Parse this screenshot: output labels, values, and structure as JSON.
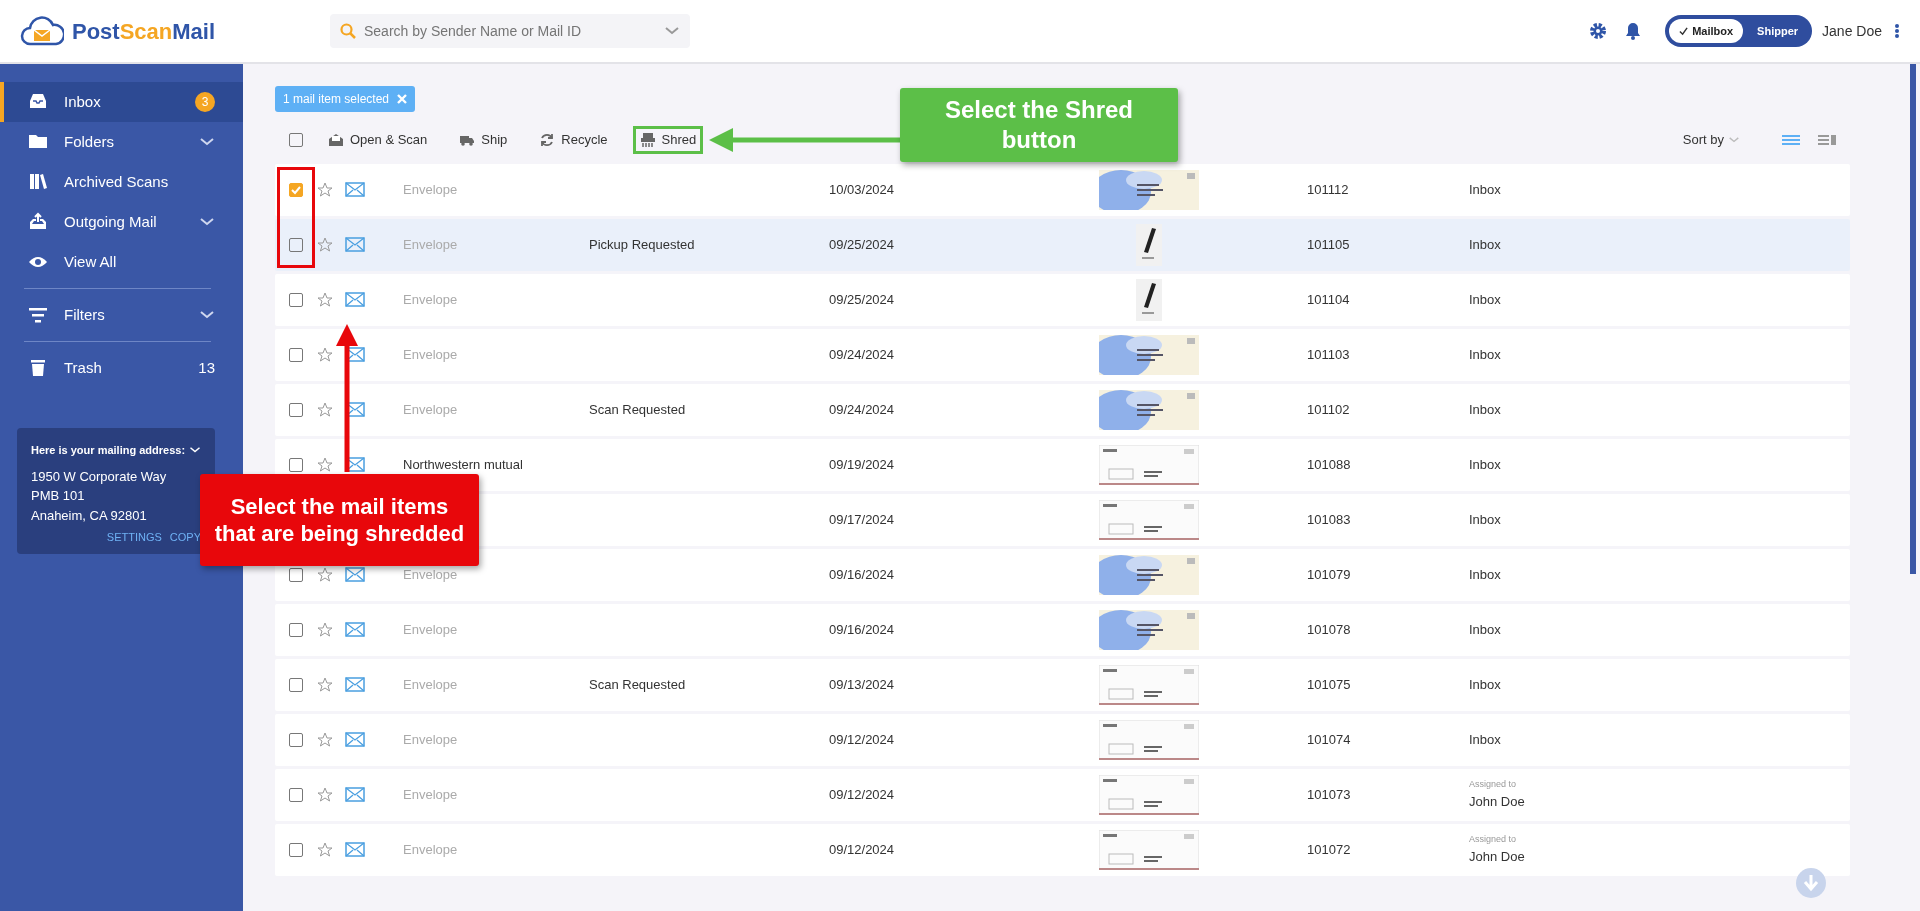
{
  "header": {
    "logo": [
      "Post",
      "Scan",
      "Mail"
    ],
    "search": {
      "placeholder": "Search by Sender Name or Mail ID"
    },
    "mode_toggle": [
      {
        "label": "Mailbox",
        "selected": true
      },
      {
        "label": "Shipper",
        "selected": false
      }
    ],
    "user": "Jane Doe"
  },
  "sidebar": {
    "groups": [
      [
        {
          "kind": "inbox",
          "label": "Inbox",
          "badge": "3",
          "selected": true
        },
        {
          "kind": "folder",
          "label": "Folders",
          "expanded": false,
          "selected": false
        },
        {
          "kind": "archive",
          "label": "Archived Scans",
          "selected": false
        },
        {
          "kind": "outbox",
          "label": "Outgoing Mail",
          "expanded": false,
          "selected": false
        },
        {
          "kind": "eye",
          "label": "View All",
          "selected": false
        }
      ],
      [
        {
          "kind": "filter",
          "label": "Filters",
          "expanded": false,
          "selected": false
        }
      ],
      [
        {
          "kind": "trash",
          "label": "Trash",
          "count": "13",
          "selected": false
        }
      ]
    ],
    "address": {
      "title": "Here is your mailing address:",
      "expanded": true,
      "lines": [
        "1950 W Corporate Way",
        "PMB 101",
        "Anaheim, CA 92801"
      ],
      "links": [
        "SETTINGS",
        "COPY"
      ]
    }
  },
  "toolbar": {
    "selection_chip": "1 mail item selected",
    "select_all": false,
    "actions": [
      {
        "kind": "scan",
        "label": "Open & Scan",
        "highlighted": false
      },
      {
        "kind": "truck",
        "label": "Ship",
        "highlighted": false
      },
      {
        "kind": "recycle",
        "label": "Recycle",
        "highlighted": false
      },
      {
        "kind": "shred",
        "label": "Shred",
        "highlighted": true
      }
    ],
    "sort_label": "Sort by",
    "views": [
      {
        "kind": "list",
        "selected": true
      },
      {
        "kind": "grid",
        "selected": false
      }
    ]
  },
  "rows": [
    {
      "checked": true,
      "hovered": false,
      "sender": "Envelope",
      "sender_generic": true,
      "date": "10/03/2024",
      "id": "101112",
      "folder": "Inbox"
    },
    {
      "checked": false,
      "hovered": true,
      "sender": "Envelope",
      "sender_generic": true,
      "status": "Pickup Requested",
      "date": "09/25/2024",
      "id": "101105",
      "folder": "Inbox"
    },
    {
      "checked": false,
      "hovered": false,
      "sender": "Envelope",
      "sender_generic": true,
      "date": "09/25/2024",
      "id": "101104",
      "folder": "Inbox"
    },
    {
      "checked": false,
      "hovered": false,
      "sender": "Envelope",
      "sender_generic": true,
      "date": "09/24/2024",
      "id": "101103",
      "folder": "Inbox"
    },
    {
      "checked": false,
      "hovered": false,
      "sender": "Envelope",
      "sender_generic": true,
      "status": "Scan Requested",
      "date": "09/24/2024",
      "id": "101102",
      "folder": "Inbox"
    },
    {
      "checked": false,
      "hovered": false,
      "sender": "Northwestern mutual",
      "sender_generic": false,
      "date": "09/19/2024",
      "id": "101088",
      "folder": "Inbox"
    },
    {
      "hovered": false,
      "date": "09/17/2024",
      "id": "101083",
      "folder": "Inbox"
    },
    {
      "checked": false,
      "hovered": false,
      "sender": "Envelope",
      "sender_generic": true,
      "date": "09/16/2024",
      "id": "101079",
      "folder": "Inbox"
    },
    {
      "checked": false,
      "hovered": false,
      "sender": "Envelope",
      "sender_generic": true,
      "date": "09/16/2024",
      "id": "101078",
      "folder": "Inbox"
    },
    {
      "checked": false,
      "hovered": false,
      "sender": "Envelope",
      "sender_generic": true,
      "status": "Scan Requested",
      "date": "09/13/2024",
      "id": "101075",
      "folder": "Inbox"
    },
    {
      "checked": false,
      "hovered": false,
      "sender": "Envelope",
      "sender_generic": true,
      "date": "09/12/2024",
      "id": "101074",
      "folder": "Inbox"
    },
    {
      "checked": false,
      "hovered": false,
      "sender": "Envelope",
      "sender_generic": true,
      "date": "09/12/2024",
      "id": "101073",
      "assigned_label": "Assigned to",
      "assignee": "John Doe"
    },
    {
      "checked": false,
      "hovered": false,
      "sender": "Envelope",
      "sender_generic": true,
      "date": "09/12/2024",
      "id": "101072",
      "assigned_label": "Assigned to",
      "assignee": "John Doe"
    }
  ],
  "annotations": [
    {
      "kind": "shred",
      "text": "Select the Shred button",
      "color": "#5cbf48"
    },
    {
      "kind": "select",
      "text": "Select the mail items that are being shredded",
      "color": "#e8070b"
    }
  ]
}
